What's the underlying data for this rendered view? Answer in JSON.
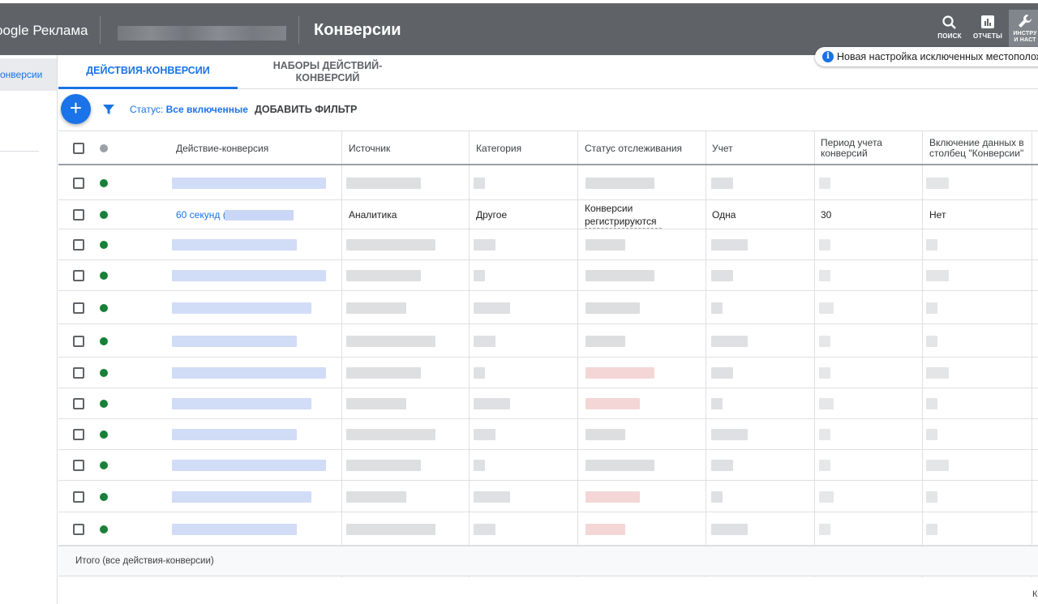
{
  "header": {
    "brand": "oogle Реклама",
    "title": "Конверсии",
    "buttons": [
      {
        "label": "ПОИСК",
        "icon": "search-icon"
      },
      {
        "label": "ОТЧЕТЫ",
        "icon": "reports-icon"
      },
      {
        "label": "ИНСТРУ\nИ НАСТ",
        "icon": "wrench-icon"
      }
    ],
    "notice": "Новая настройка исключенных местополож"
  },
  "sidebar": {
    "active_item": "онверсии"
  },
  "tabs": [
    {
      "label": "ДЕЙСТВИЯ-КОНВЕРСИИ",
      "active": true
    },
    {
      "label": "НАБОРЫ ДЕЙСТВИЙ-\nКОНВЕРСИЙ",
      "active": false
    }
  ],
  "filter": {
    "status_label": "Статус: ",
    "status_value": "Все включенные",
    "add_filter": "ДОБАВИТЬ ФИЛЬТР"
  },
  "table": {
    "columns": [
      "Действие-конверсия",
      "Источник",
      "Категория",
      "Статус отслеживания",
      "Учет",
      "Период учета конверсий",
      "Включение данных в столбец \"Конверсии\""
    ],
    "visible_row": {
      "name": "60 секунд (",
      "source": "Аналитика",
      "category": "Другое",
      "status": "Конверсии регистрируются",
      "count": "Одна",
      "period": "30",
      "include": "Нет"
    },
    "total_label": "Итого (все действия-конверсии)"
  },
  "colors": {
    "accent": "#1a73e8",
    "topbar": "#5f6368",
    "enabled_dot": "#188038"
  },
  "footer_fragment": "К"
}
